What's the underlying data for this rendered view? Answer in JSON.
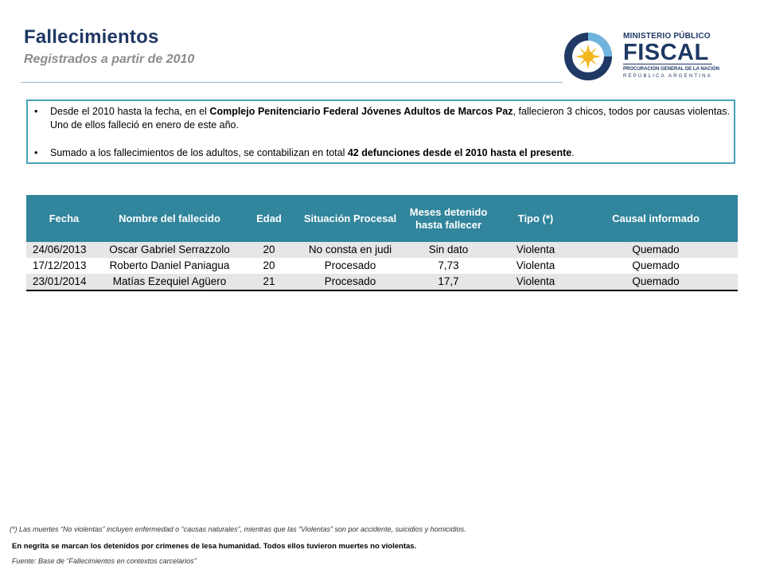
{
  "header": {
    "title": "Fallecimientos",
    "subtitle": "Registrados a partir de 2010"
  },
  "logo": {
    "line1": "MINISTERIO PÚBLICO",
    "line2": "FISCAL",
    "line3": "PROCURACIÓN GENERAL DE LA NACIÓN",
    "line4": "REPÚBLICA ARGENTINA"
  },
  "info": {
    "bullet1": {
      "pre": "Desde el 2010 hasta la fecha, en el ",
      "bold": "Complejo Penitenciario Federal Jóvenes Adultos de Marcos Paz",
      "post": ", fallecieron 3 chicos, todos por causas violentas. Uno de ellos falleció en enero de este año."
    },
    "bullet2": {
      "pre": "Sumado a los fallecimientos de los adultos, se contabilizan en total ",
      "bold": "42 defunciones desde el 2010 hasta el presente",
      "post": "."
    }
  },
  "table": {
    "headers": [
      "Fecha",
      "Nombre del fallecido",
      "Edad",
      "Situación Procesal",
      "Meses detenido hasta fallecer",
      "Tipo (*)",
      "Causal informado"
    ],
    "rows": [
      [
        "24/06/2013",
        "Oscar Gabriel Serrazzolo",
        "20",
        "No consta en judi",
        "Sin dato",
        "Violenta",
        "Quemado"
      ],
      [
        "17/12/2013",
        "Roberto Daniel Paniagua",
        "20",
        "Procesado",
        "7,73",
        "Violenta",
        "Quemado"
      ],
      [
        "23/01/2014",
        "Matías Ezequiel Agüero",
        "21",
        "Procesado",
        "17,7",
        "Violenta",
        "Quemado"
      ]
    ]
  },
  "footnotes": {
    "note1": "(*) Las muertes “No violentas” incluyen enfermedad o “causas naturales”, mientras que las “Violentas” son por accidente, suicidios y homicidios.",
    "note2": "En negrita se marcan los detenidos por crímenes de lesa humanidad. Todos ellos tuvieron muertes no violentas.",
    "note3": "Fuente: Base de “Fallecimientos en contextos carcelarios”"
  },
  "colors": {
    "title": "#1f3864",
    "table_header": "#31859c",
    "box_border": "#4aa3b8"
  }
}
